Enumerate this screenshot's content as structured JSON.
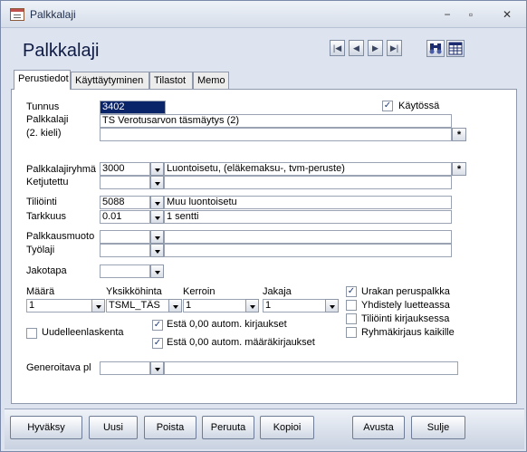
{
  "window": {
    "title": "Palkkalaji",
    "minimize": "−",
    "restore": "▫",
    "close": "✕"
  },
  "form": {
    "title": "Palkkalaji"
  },
  "nav": {
    "first": "|◀",
    "prev": "◀",
    "next": "▶",
    "last": "▶|"
  },
  "tabs": [
    "Perustiedot",
    "Käyttäytyminen",
    "Tilastot",
    "Memo"
  ],
  "fields": {
    "tunnus": {
      "label": "Tunnus",
      "value": "3402"
    },
    "kaytossa": {
      "label": "Käytössä",
      "checked": "✓"
    },
    "palkkalaji": {
      "label": "Palkkalaji",
      "value": "TS Verotusarvon täsmäytys (2)"
    },
    "palkkalaji2": {
      "label": "(2. kieli)",
      "value": ""
    },
    "star": "*",
    "palkkalajiryhma": {
      "label": "Palkkalajiryhmä",
      "code": "3000",
      "desc": "Luontoisetu, (eläkemaksu-, tvm-peruste)"
    },
    "ketjutettu": {
      "label": "Ketjutettu",
      "code": "",
      "desc": ""
    },
    "tilioint": {
      "label": "Tiliöinti",
      "code": "5088",
      "desc": "Muu luontoisetu"
    },
    "tarkkuus": {
      "label": "Tarkkuus",
      "code": "0.01",
      "desc": "1 sentti"
    },
    "palkkausmuoto": {
      "label": "Palkkausmuoto",
      "code": "",
      "desc": ""
    },
    "tyolaji": {
      "label": "Työlaji",
      "code": "",
      "desc": ""
    },
    "jakotapa": {
      "label": "Jakotapa",
      "code": ""
    },
    "maara": {
      "label": "Määrä",
      "value": "1"
    },
    "yksikkohinta": {
      "label": "Yksikköhinta",
      "value": "TSML_TÄS"
    },
    "kerroin": {
      "label": "Kerroin",
      "value": "1"
    },
    "jakaja": {
      "label": "Jakaja",
      "value": "1"
    },
    "generoitava": {
      "label": "Generoitava pl",
      "code": "",
      "desc": ""
    }
  },
  "checks": {
    "urakan": {
      "label": "Urakan peruspalkka",
      "checked": "✓"
    },
    "yhdistely": {
      "label": "Yhdistely luetteassa",
      "checked": ""
    },
    "tilioint_kirj": {
      "label": "Tiliöinti kirjauksessa",
      "checked": ""
    },
    "ryhmakirjaus": {
      "label": "Ryhmäkirjaus kaikille",
      "checked": ""
    },
    "uudelleen": {
      "label": "Uudelleenlaskenta",
      "checked": ""
    },
    "esta_kirj": {
      "label": "Estä 0,00 autom. kirjaukset",
      "checked": "✓"
    },
    "esta_maara": {
      "label": "Estä 0,00 autom. määräkirjaukset",
      "checked": "✓"
    }
  },
  "buttons": {
    "hyvaksy": "Hyväksy",
    "uusi": "Uusi",
    "poista": "Poista",
    "peruuta": "Peruuta",
    "kopioi": "Kopioi",
    "avusta": "Avusta",
    "sulje": "Sulje"
  },
  "icons": [
    "app-table-icon",
    "binoculars-icon",
    "table-grid-icon"
  ]
}
